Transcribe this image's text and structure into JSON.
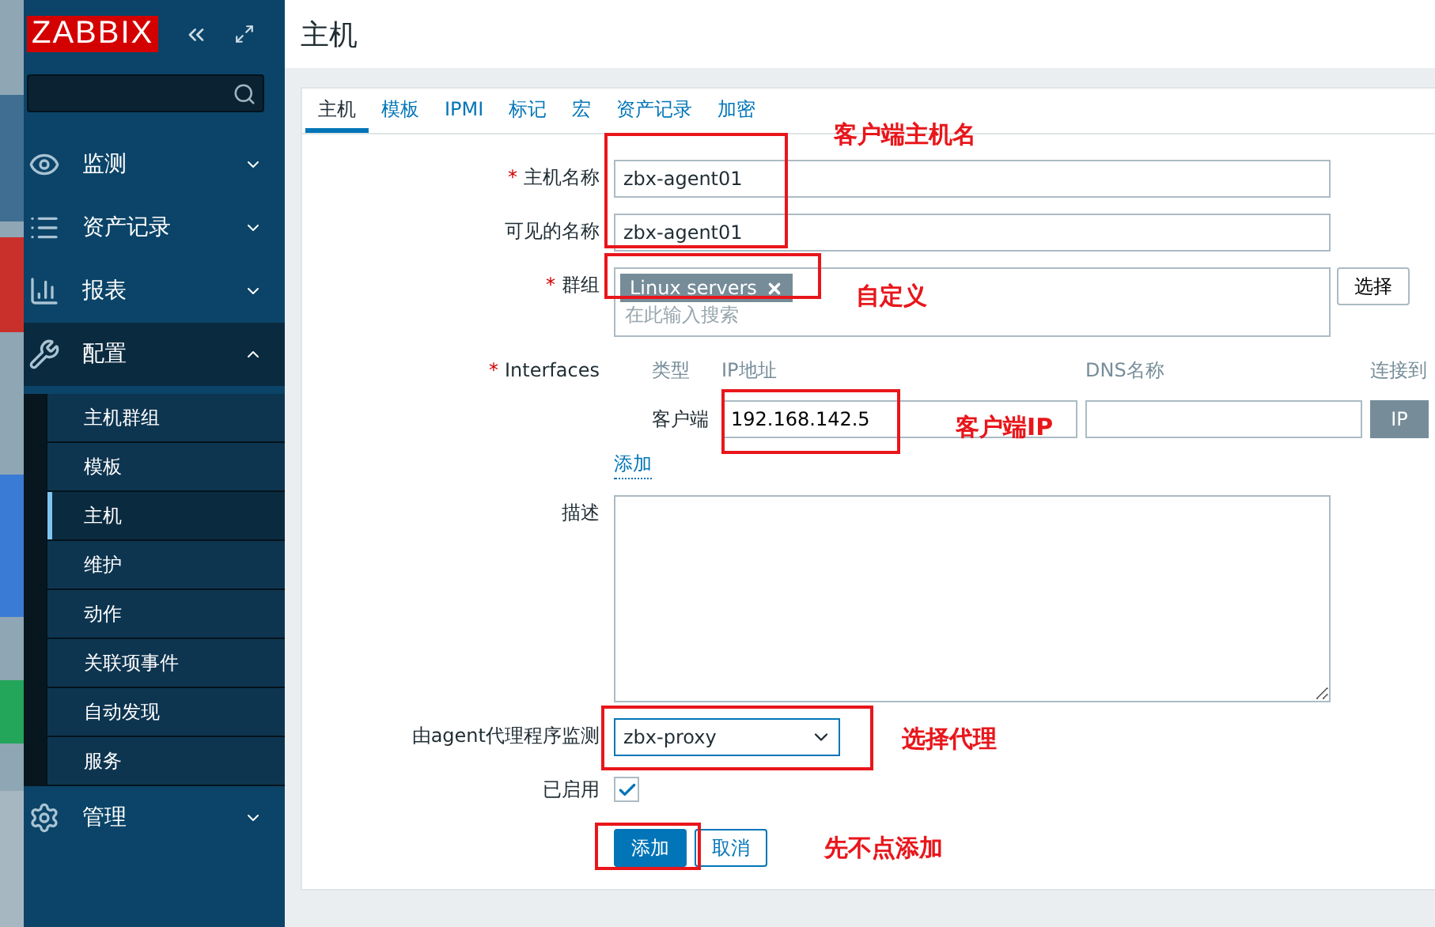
{
  "sidebar": {
    "logo": "ZABBIX",
    "menu": [
      {
        "label": "监测",
        "expanded": false
      },
      {
        "label": "资产记录",
        "expanded": false
      },
      {
        "label": "报表",
        "expanded": false
      },
      {
        "label": "配置",
        "expanded": true,
        "children": [
          {
            "label": "主机群组",
            "selected": false
          },
          {
            "label": "模板",
            "selected": false
          },
          {
            "label": "主机",
            "selected": true
          },
          {
            "label": "维护",
            "selected": false
          },
          {
            "label": "动作",
            "selected": false
          },
          {
            "label": "关联项事件",
            "selected": false
          },
          {
            "label": "自动发现",
            "selected": false
          },
          {
            "label": "服务",
            "selected": false
          }
        ]
      },
      {
        "label": "管理",
        "expanded": false
      }
    ]
  },
  "page_title": "主机",
  "tabs": [
    {
      "label": "主机",
      "selected": true
    },
    {
      "label": "模板",
      "selected": false
    },
    {
      "label": "IPMI",
      "selected": false
    },
    {
      "label": "标记",
      "selected": false
    },
    {
      "label": "宏",
      "selected": false
    },
    {
      "label": "资产记录",
      "selected": false
    },
    {
      "label": "加密",
      "selected": false
    }
  ],
  "form": {
    "host_name": {
      "label": "主机名称",
      "required_mark": "*",
      "value": "zbx-agent01"
    },
    "visible_name": {
      "label": "可见的名称",
      "value": "zbx-agent01"
    },
    "groups": {
      "label": "群组",
      "required_mark": "*",
      "tags": [
        "Linux servers"
      ],
      "placeholder": "在此输入搜索",
      "button": "选择"
    },
    "interfaces": {
      "label": "Interfaces",
      "required_mark": "*",
      "columns": [
        "类型",
        "IP地址",
        "DNS名称",
        "连接到"
      ],
      "row": {
        "type": "客户端",
        "ip": "192.168.142.5",
        "connect": "IP"
      },
      "add_link": "添加"
    },
    "description": {
      "label": "描述"
    },
    "proxy": {
      "label": "由agent代理程序监测",
      "value": "zbx-proxy"
    },
    "enabled": {
      "label": "已启用",
      "checked": true
    },
    "buttons": [
      "添加",
      "取消"
    ]
  },
  "annotations": [
    "客户端主机名",
    "自定义",
    "客户端IP",
    "选择代理",
    "先不点添加"
  ]
}
